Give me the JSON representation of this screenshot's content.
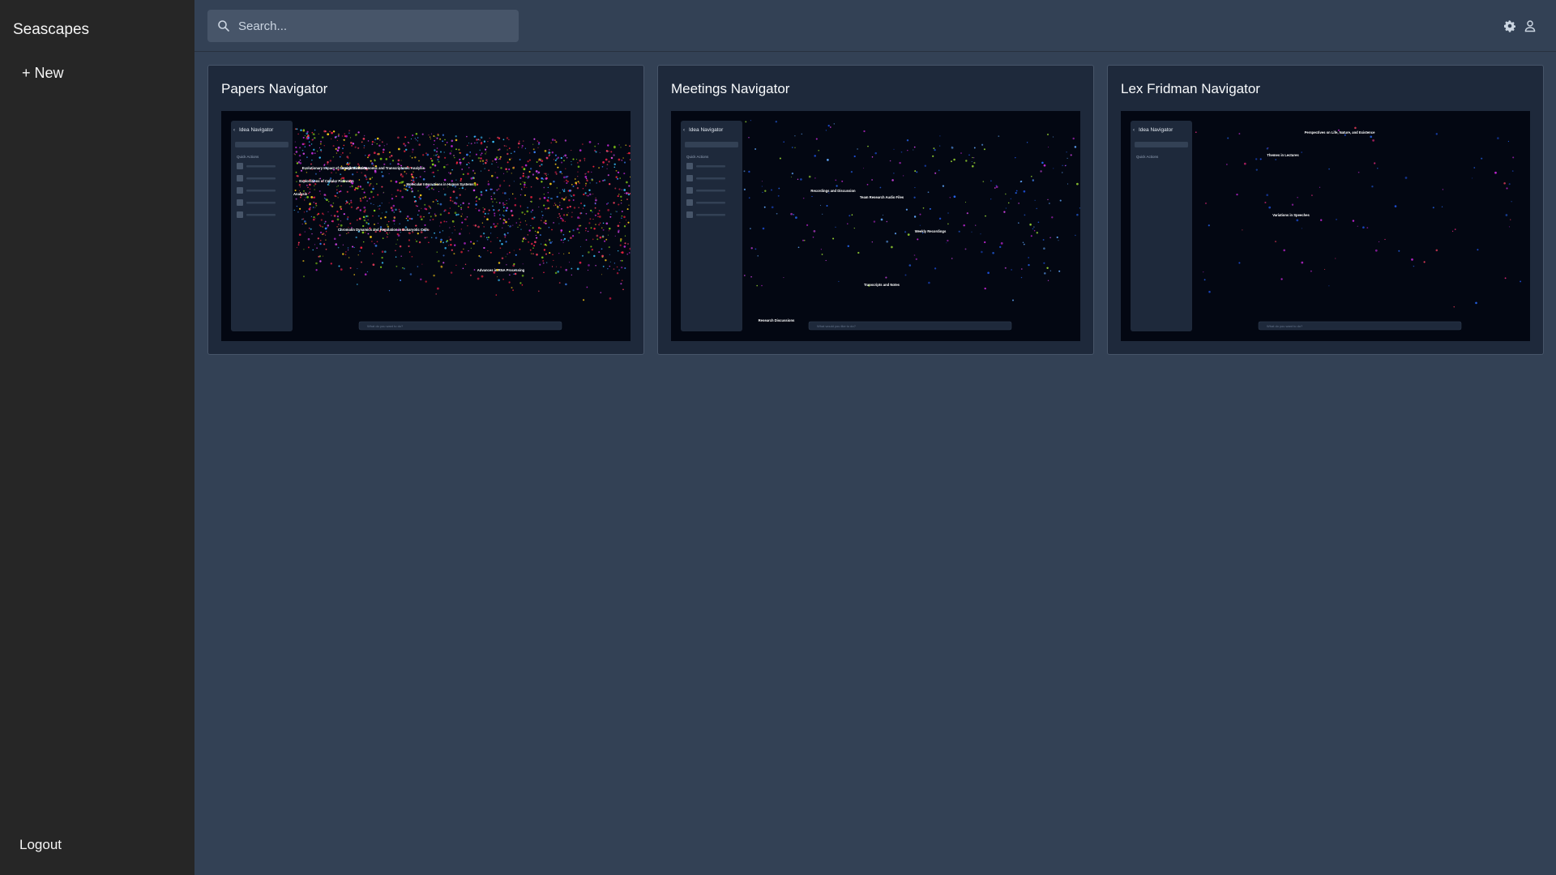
{
  "app": {
    "brand": "Seascapes"
  },
  "sidebar": {
    "new_label": "+ New",
    "logout_label": "Logout"
  },
  "search": {
    "placeholder": "Search..."
  },
  "icons": {
    "search": "search-icon",
    "settings": "gear-icon",
    "user": "user-icon"
  },
  "colors": {
    "sidebar_bg": "#262626",
    "main_bg": "#334155",
    "card_bg": "#1e293b",
    "thumb_bg": "#030712"
  },
  "cards": [
    {
      "title": "Papers Navigator",
      "preview": {
        "panel_title": "Idea Navigator",
        "quick_actions": "Quick Actions",
        "input_placeholder": "What do you want to do?",
        "clusters": [
          "Evolutionary Impact of Genetic Variation",
          "Insights into Genomic and Transcriptomic Analysis",
          "Explorations of Cellular Pathways",
          "Molecular Interactions in Human Systems",
          "Protein Structure Analysis",
          "Chromatin Dynamics and Regulation in Eukaryotic Cells",
          "Advances in RNA Processing"
        ]
      }
    },
    {
      "title": "Meetings Navigator",
      "preview": {
        "panel_title": "Idea Navigator",
        "quick_actions": "Quick Actions",
        "input_placeholder": "What would you like to do?",
        "clusters": [
          "Recordings and Discussion",
          "Team Research Audio Files",
          "Weekly Recordings",
          "Transcripts and Notes",
          "Research Discussions"
        ]
      }
    },
    {
      "title": "Lex Fridman Navigator",
      "preview": {
        "panel_title": "Idea Navigator",
        "quick_actions": "Quick Actions",
        "input_placeholder": "What do you want to do?",
        "clusters": [
          "Perspectives on Life, Nature, and Existence",
          "Themes in Lectures",
          "Variations in Speeches"
        ]
      }
    }
  ]
}
